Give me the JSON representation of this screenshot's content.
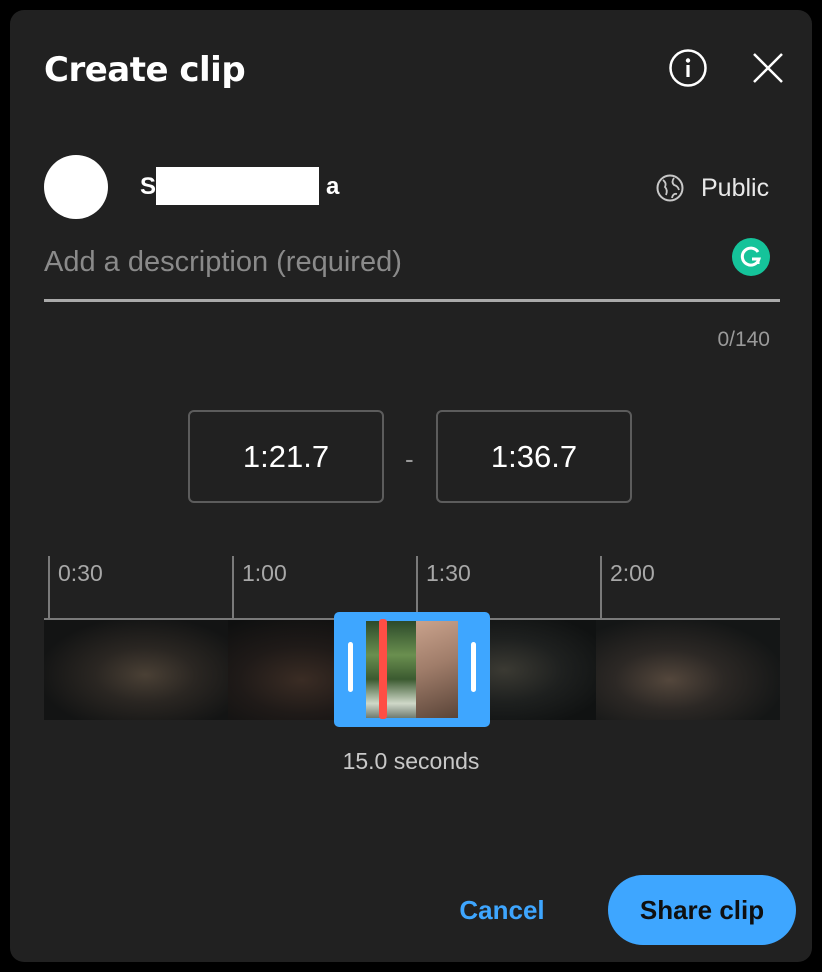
{
  "dialog": {
    "title": "Create clip",
    "info_icon": "info-icon",
    "close_icon": "close-icon"
  },
  "channel": {
    "name_first": "S",
    "name_last": "a",
    "visibility": "Public",
    "visibility_icon": "globe-icon"
  },
  "description": {
    "placeholder": "Add a description (required)",
    "value": "",
    "counter": "0/140"
  },
  "clip": {
    "start": "1:21.7",
    "separator": "-",
    "end": "1:36.7",
    "duration_label": "15.0 seconds"
  },
  "timeline": {
    "ticks": [
      "0:30",
      "1:00",
      "1:30",
      "2:00"
    ]
  },
  "actions": {
    "cancel": "Cancel",
    "share": "Share clip"
  },
  "colors": {
    "accent": "#3ea6ff",
    "playhead": "#ff4e45",
    "background": "#212121",
    "grammarly": "#15c39a"
  }
}
